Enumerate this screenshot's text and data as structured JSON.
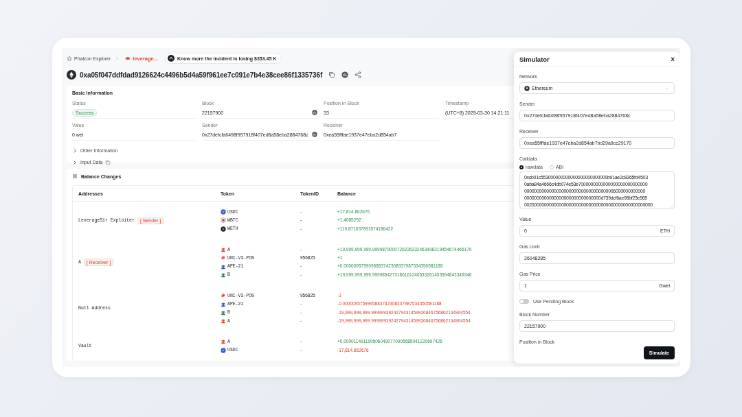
{
  "breadcrumb": {
    "home": "Phalcon Explorer",
    "project": "leverage...",
    "incident": "Know more the incident in losing $353.45 K"
  },
  "transaction": {
    "hash": "0xa05f047ddfdad9126624c4496b5d4a59f961ee7c091e7b4e38cee86f1335736f"
  },
  "basic_info": {
    "title": "Basic Information",
    "fields": [
      {
        "label": "Status",
        "value": "Success",
        "kind": "badge"
      },
      {
        "label": "Block",
        "value": "22157900",
        "kind": "with-icon"
      },
      {
        "label": "Position In Block",
        "value": "33",
        "kind": "plain"
      },
      {
        "label": "Timestamp",
        "value": "(UTC+8) 2025-03-30 14:21:11",
        "kind": "plain"
      },
      {
        "label": "Value",
        "value": "0 wei",
        "kind": "plain"
      },
      {
        "label": "Sender",
        "value": "0x27defcfa6498f957918f407ed8a58eba2884768c",
        "kind": "with-icon"
      },
      {
        "label": "Receiver",
        "value": "0xea55fffae1937e47eba2d854ab7",
        "kind": "plain"
      }
    ],
    "sections": [
      {
        "label": "Other Information",
        "expanded": false,
        "copyable": false
      },
      {
        "label": "Input Data",
        "expanded": false,
        "copyable": true
      }
    ]
  },
  "balance_changes": {
    "title": "Balance Changes",
    "columns": [
      "Addresses",
      "Token",
      "TokenID",
      "Balance"
    ],
    "rows": [
      {
        "address": "LeverageSir Exploiter",
        "tag": "[ Sender ]",
        "tokens": [
          {
            "symbol": "USDC",
            "kind": "coin",
            "color": "#3b66c4",
            "token_id": "-",
            "balance": "+17,814.862676",
            "positive": true
          },
          {
            "symbol": "WBTC",
            "kind": "ring",
            "color": "#c0523f",
            "token_id": "-",
            "balance": "+1.4085292",
            "positive": true
          },
          {
            "symbol": "WETH",
            "kind": "coin",
            "color": "#2b2b33",
            "token_id": "-",
            "balance": "+119.871037891574186422",
            "positive": true
          }
        ]
      },
      {
        "address": "A",
        "tag": "[ Receiver ]",
        "tokens": [
          {
            "symbol": "A",
            "kind": "figure",
            "color": "#d9533b",
            "token_id": "-",
            "balance": "+19,999,999,999.9999879000726226332463498219454674466179",
            "positive": true
          },
          {
            "symbol": "UNI-V3-POS",
            "kind": "swirl",
            "color": "#e0574a",
            "token_id": "956825",
            "balance": "+1",
            "positive": true
          },
          {
            "symbol": "APE-21",
            "kind": "figure",
            "color": "#3f56b5",
            "token_id": "-",
            "balance": "+0.0000095759995883742308337987534350581188",
            "positive": true
          },
          {
            "symbol": "B",
            "kind": "figure",
            "color": "#3f7a5a",
            "token_id": "-",
            "balance": "+19,999,999,999.9999854273186161240533261453594843349346",
            "positive": true
          }
        ]
      },
      {
        "address": "Null Address",
        "tokens": [
          {
            "symbol": "UNI-V3-POS",
            "kind": "swirl",
            "color": "#e0574a",
            "token_id": "956825",
            "balance": "-1",
            "positive": false
          },
          {
            "symbol": "APE-21",
            "kind": "figure",
            "color": "#3f56b5",
            "token_id": "-",
            "balance": "-0.0000095759995883742308337987534350581188",
            "positive": false
          },
          {
            "symbol": "B",
            "kind": "figure",
            "color": "#3f7a5a",
            "token_id": "-",
            "balance": "-19,999,999,999.9999993924279431459926846756862134904554",
            "positive": false
          },
          {
            "symbol": "A",
            "kind": "figure",
            "color": "#d9533b",
            "token_id": "-",
            "balance": "-19,999,999,999.9999993924279431459926846756862134904554",
            "positive": false
          }
        ]
      },
      {
        "address": "Vault",
        "tokens": [
          {
            "symbol": "A",
            "kind": "figure",
            "color": "#d9533b",
            "token_id": "-",
            "balance": "+0.0000114911995060490770005585041220697426",
            "positive": true
          },
          {
            "symbol": "USDC",
            "kind": "coin",
            "color": "#3b66c4",
            "token_id": "-",
            "balance": "-17,814.862676",
            "positive": false
          }
        ]
      }
    ]
  },
  "simulator": {
    "title": "Simulator",
    "close": "×",
    "network": {
      "label": "Network",
      "value": "Ethereum"
    },
    "sender": {
      "label": "Sender",
      "value": "0x27defcfa6498f957918f407ed8a58eba2884768c"
    },
    "receiver": {
      "label": "Receiver",
      "value": "0xea55fffae1937e47eba2d854ab7bd29a9cc29170"
    },
    "calldata": {
      "label": "Calldata",
      "modes": [
        {
          "label": "rawdata",
          "selected": true
        },
        {
          "label": "ABI",
          "selected": false
        }
      ],
      "lines": [
        "0xcb01c553000000000000000000000000b91ae2c8365fd4503",
        "0aba84a4666c4db074e53e7000000000000000000000000000",
        "0000000000000000000000000000000000006000000000000",
        "0000000000000000000000000000000d739dcf6ae98bf23e565",
        "0020000000000000000000000000000000000000000000000000"
      ]
    },
    "value": {
      "label": "Value",
      "value": "0",
      "unit": "ETH"
    },
    "gas_limit": {
      "label": "Gas Limit",
      "value": "26048285"
    },
    "gas_price": {
      "label": "Gas Price",
      "value": "1",
      "unit": "Gwei"
    },
    "pending": {
      "label": "Use Pending Block",
      "on": false
    },
    "block_number": {
      "label": "Block Number",
      "value": "22157900"
    },
    "position_label": "Position in Block",
    "submit": "Simulate"
  }
}
